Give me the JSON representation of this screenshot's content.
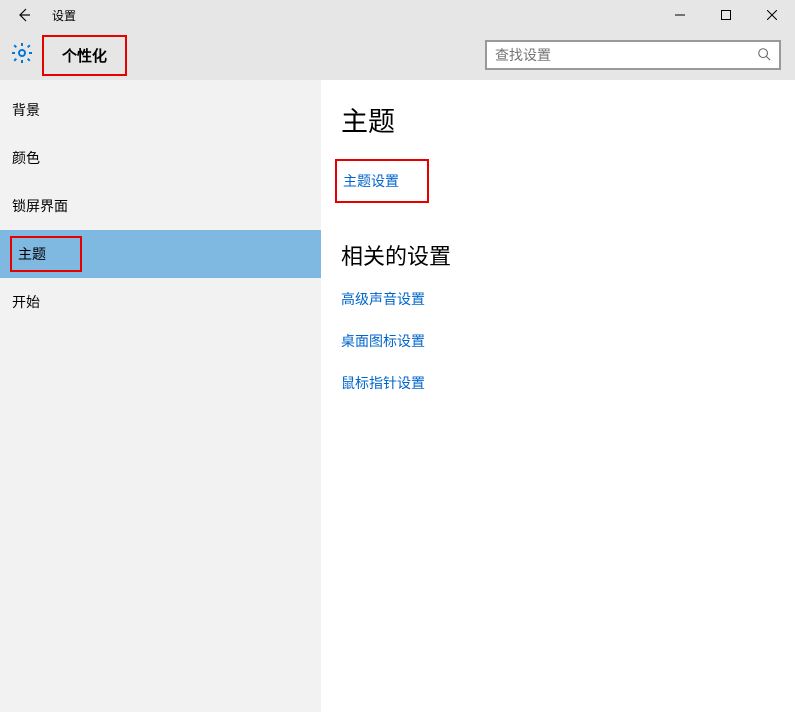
{
  "window": {
    "title": "设置"
  },
  "header": {
    "section_title": "个性化",
    "search_placeholder": "查找设置"
  },
  "sidebar": {
    "items": [
      {
        "label": "背景"
      },
      {
        "label": "颜色"
      },
      {
        "label": "锁屏界面"
      },
      {
        "label": "主题"
      },
      {
        "label": "开始"
      }
    ]
  },
  "main": {
    "heading": "主题",
    "theme_settings_link": "主题设置",
    "related_heading": "相关的设置",
    "related_links": [
      "高级声音设置",
      "桌面图标设置",
      "鼠标指针设置"
    ]
  }
}
